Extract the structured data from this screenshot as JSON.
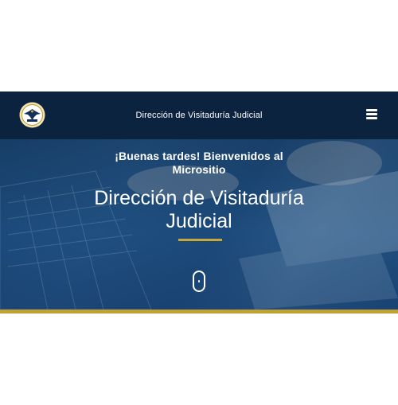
{
  "header": {
    "title": "Dirección de Visitaduría Judicial",
    "logo_icon": "judicial-seal-icon",
    "menu_icon": "hamburger-menu-icon"
  },
  "hero": {
    "greeting": "¡Buenas tardes! Bienvenidos al Micrositio",
    "title": "Dirección de Visitaduría Judicial",
    "scroll_icon": "scroll-down-mouse-icon"
  },
  "colors": {
    "header_bg": "#0c2340",
    "hero_overlay": "#1a4a7c",
    "accent_gold": "#c0a234",
    "text": "#ffffff"
  }
}
